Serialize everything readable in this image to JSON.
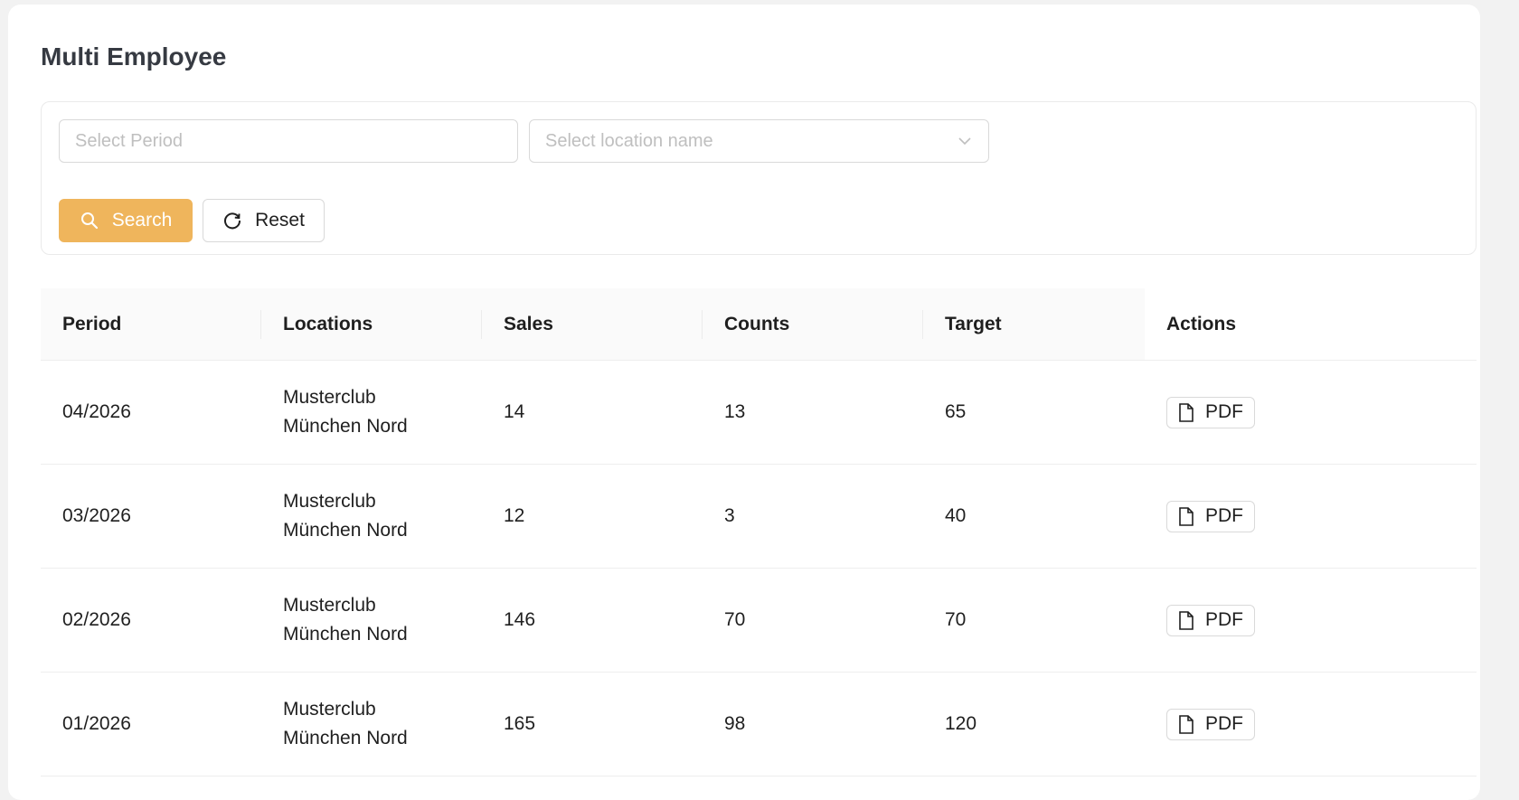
{
  "page": {
    "title": "Multi Employee"
  },
  "filters": {
    "period_placeholder": "Select Period",
    "location_placeholder": "Select location name",
    "search_label": "Search",
    "reset_label": "Reset"
  },
  "table": {
    "columns": [
      "Period",
      "Locations",
      "Sales",
      "Counts",
      "Target",
      "Actions"
    ],
    "rows": [
      {
        "period": "04/2026",
        "location_line1": "Musterclub",
        "location_line2": "München Nord",
        "sales": "14",
        "counts": "13",
        "target": "65",
        "action": "PDF"
      },
      {
        "period": "03/2026",
        "location_line1": "Musterclub",
        "location_line2": "München Nord",
        "sales": "12",
        "counts": "3",
        "target": "40",
        "action": "PDF"
      },
      {
        "period": "02/2026",
        "location_line1": "Musterclub",
        "location_line2": "München Nord",
        "sales": "146",
        "counts": "70",
        "target": "70",
        "action": "PDF"
      },
      {
        "period": "01/2026",
        "location_line1": "Musterclub",
        "location_line2": "München Nord",
        "sales": "165",
        "counts": "98",
        "target": "120",
        "action": "PDF"
      }
    ]
  },
  "colors": {
    "accent": "#efb55c",
    "border": "#d9d9d9",
    "header_bg": "#fafafa"
  },
  "icons": {
    "search": "search-icon",
    "reset": "reload-icon",
    "pdf": "file-icon",
    "dropdown": "chevron-down-icon"
  }
}
